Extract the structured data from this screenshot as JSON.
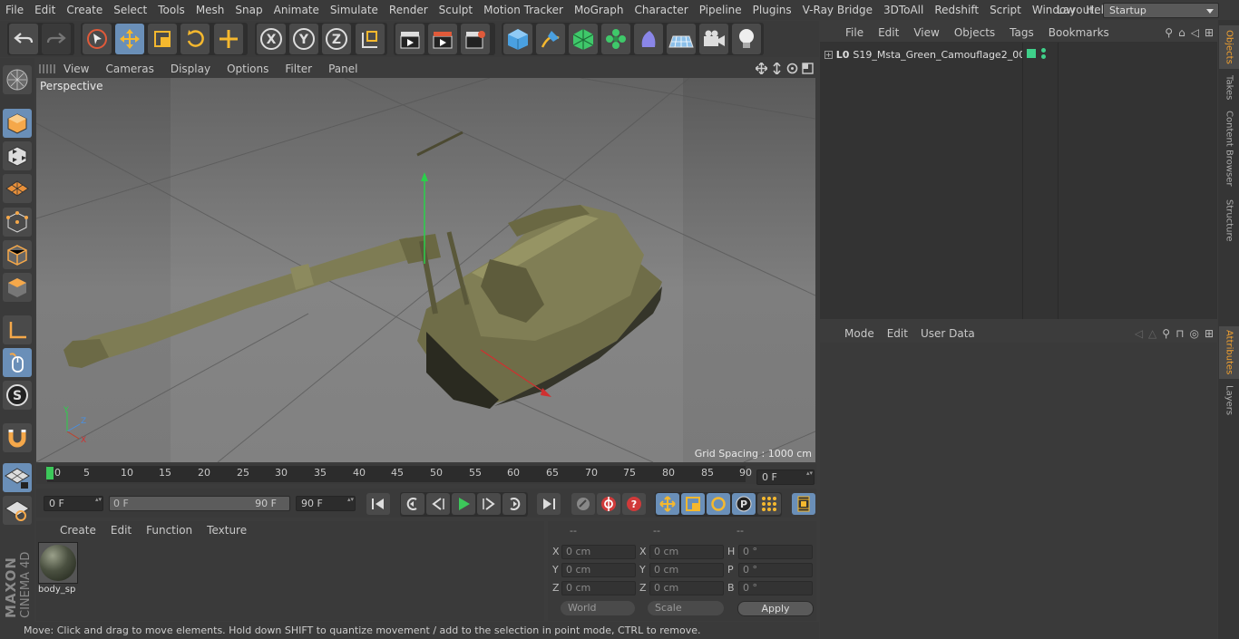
{
  "menubar": {
    "items": [
      "File",
      "Edit",
      "Create",
      "Select",
      "Tools",
      "Mesh",
      "Snap",
      "Animate",
      "Simulate",
      "Render",
      "Sculpt",
      "Motion Tracker",
      "MoGraph",
      "Character",
      "Pipeline",
      "Plugins",
      "V-Ray Bridge",
      "3DToAll",
      "Redshift",
      "Script",
      "Window",
      "Help"
    ],
    "layout_label": "Layout:",
    "layout_value": "Startup"
  },
  "viewport": {
    "menu": [
      "View",
      "Cameras",
      "Display",
      "Options",
      "Filter",
      "Panel"
    ],
    "label": "Perspective",
    "grid_spacing": "Grid Spacing : 1000 cm",
    "axis": {
      "y": "Y",
      "z": "Z",
      "x": "X"
    }
  },
  "timeline": {
    "ticks": [
      "0",
      "5",
      "10",
      "15",
      "20",
      "25",
      "30",
      "35",
      "40",
      "45",
      "50",
      "55",
      "60",
      "65",
      "70",
      "75",
      "80",
      "85",
      "90"
    ],
    "current_frame": "0 F"
  },
  "animation": {
    "start_field": "0 F",
    "range_start": "0 F",
    "range_end": "90 F",
    "end_field": "90 F"
  },
  "material_manager": {
    "menu": [
      "Create",
      "Edit",
      "Function",
      "Texture"
    ],
    "material_name": "body_sp"
  },
  "coordinates": {
    "headers": [
      "--",
      "--",
      "--"
    ],
    "rows": [
      {
        "label_a": "X",
        "val_a": "0 cm",
        "label_b": "X",
        "val_b": "0 cm",
        "label_c": "H",
        "val_c": "0 °"
      },
      {
        "label_a": "Y",
        "val_a": "0 cm",
        "label_b": "Y",
        "val_b": "0 cm",
        "label_c": "P",
        "val_c": "0 °"
      },
      {
        "label_a": "Z",
        "val_a": "0 cm",
        "label_b": "Z",
        "val_b": "0 cm",
        "label_c": "B",
        "val_c": "0 °"
      }
    ],
    "world_select": "World",
    "scale_select": "Scale",
    "apply": "Apply"
  },
  "object_manager": {
    "menu": [
      "File",
      "Edit",
      "View",
      "Objects",
      "Tags",
      "Bookmarks"
    ],
    "object_name": "S19_Msta_Green_Camouflage2_001"
  },
  "attributes": {
    "menu": [
      "Mode",
      "Edit",
      "User Data"
    ]
  },
  "right_tabs": [
    "Objects",
    "Takes",
    "Content Browser",
    "Structure",
    "Attributes",
    "Layers"
  ],
  "brand": {
    "line1": "MAXON",
    "line2": "CINEMA 4D"
  },
  "status": "Move: Click and drag to move elements. Hold down SHIFT to quantize movement / add to the selection in point mode, CTRL to remove.",
  "colors": {
    "accent_blue": "#6a8fb8",
    "record_red": "#d03a3a",
    "play_green": "#3cc85a",
    "tank": "#7c7a52"
  }
}
